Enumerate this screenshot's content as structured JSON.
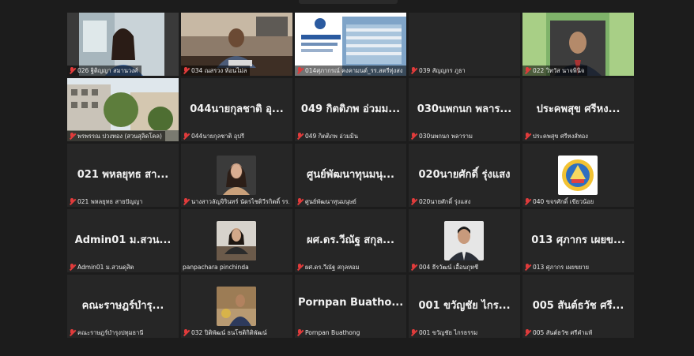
{
  "tiles": [
    {
      "label": "026 ฐิติญญา สมานวงศ์",
      "muted": true,
      "video": "woman"
    },
    {
      "label": "034 ณสรวง ท้อนไม่ล",
      "muted": true,
      "video": "man-desk"
    },
    {
      "label": "014ศุภากรณ์ คงคามนต์_รร.สตรีทุ่งสง",
      "muted": true,
      "video": "slide"
    },
    {
      "label": "039 สัญญกร ภูธา",
      "muted": true,
      "video": "none"
    },
    {
      "label": "022 วิทวัส นาจพินิจ",
      "muted": true,
      "video": "man-green"
    },
    {
      "label": "พรพรรณ ปวงทอง (สวนสุลิดโคล)",
      "muted": true,
      "video": "building"
    },
    {
      "label": "044นายกุลชาติ อุปรี",
      "muted": true,
      "big": "044นายกุลชาติ อุ..."
    },
    {
      "label": "049 กิตติภพ อ่วมมิน",
      "muted": true,
      "big": "049 กิตติภพ อ่วมม..."
    },
    {
      "label": "030นพกนก พลาราม",
      "muted": true,
      "big": "030นพกนก พลาร..."
    },
    {
      "label": "ประคพสุข ศรีหงส์ทอง",
      "muted": true,
      "big": "ประคพสุข ศรีหง..."
    },
    {
      "label": "021 พหลยุทธ สายปัญญา",
      "muted": true,
      "big": "021 พหลยุทธ สา..."
    },
    {
      "label": "นางสาวลัญจิรินทร์ นัดรไชติวีรกิตติ์ รร.นิน...",
      "muted": true,
      "avatar": "woman2"
    },
    {
      "label": "ศูนย์พัฒนาทุนมนุษย์",
      "muted": true,
      "big": "ศูนย์พัฒนาทุนมนุ..."
    },
    {
      "label": "020นายศักดิ์ รุ่งแสง",
      "muted": true,
      "big": "020นายศักดิ์ รุ่งแสง"
    },
    {
      "label": "040 ขจรศักดิ์ เขียวน้อย",
      "muted": true,
      "avatar": "emblem"
    },
    {
      "label": "Admin01 ม.สวนดุสิต",
      "muted": true,
      "big": "Admin01 ม.สวน..."
    },
    {
      "label": "panpachara pinchinda",
      "muted": false,
      "avatar": "woman3"
    },
    {
      "label": "ผศ.ดร.วีณัฐ สกุลหอม",
      "muted": true,
      "big": "ผศ.ดร.วีณัฐ สกุล..."
    },
    {
      "label": "004 ธีรวัฒน์ เอื้อนกุหชี",
      "muted": true,
      "avatar": "man2"
    },
    {
      "label": "013 ศุภากร เผยขยาย",
      "muted": true,
      "big": "013 ศุภากร เผยข..."
    },
    {
      "label": "คณะราษฎร์บำรุงปทุมธานี",
      "muted": true,
      "big": "คณะราษฎร์บำรุ..."
    },
    {
      "label": "032 ปิติพัฒน์ ธนโชติกิติพัฒน์",
      "muted": true,
      "avatar": "man3"
    },
    {
      "label": "Pornpan Buathong",
      "muted": true,
      "big": "Pornpan Buatho..."
    },
    {
      "label": "001 ขวัญชัย ไกรธรรม",
      "muted": true,
      "big": "001 ขวัญชัย ไกร..."
    },
    {
      "label": "005 สันต์ธวัช ศรีคำแท้",
      "muted": true,
      "big": "005 สันต์ธวัช ศรี..."
    }
  ]
}
